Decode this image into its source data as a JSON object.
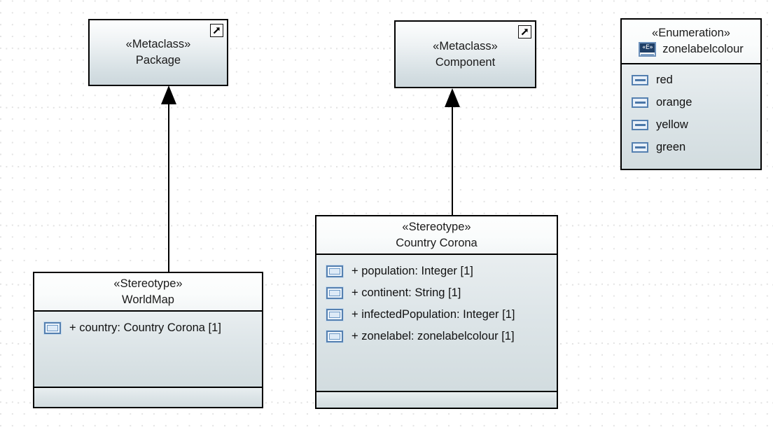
{
  "diagram": {
    "type": "uml-profile-diagram",
    "background": "#ffffff",
    "grid": "dotted"
  },
  "nodes": [
    {
      "id": "metaclass-package",
      "kind": "metaclass",
      "stereotype": "«Metaclass»",
      "name": "Package",
      "corner_icon": "external-link-icon"
    },
    {
      "id": "metaclass-component",
      "kind": "metaclass",
      "stereotype": "«Metaclass»",
      "name": "Component",
      "corner_icon": "external-link-icon"
    },
    {
      "id": "stereotype-worldmap",
      "kind": "stereotype",
      "stereotype": "«Stereotype»",
      "name": "WorldMap",
      "attributes": [
        {
          "icon": "property-icon",
          "text": "+ country: Country Corona [1]"
        }
      ]
    },
    {
      "id": "stereotype-country-corona",
      "kind": "stereotype",
      "stereotype": "«Stereotype»",
      "name": "Country Corona",
      "attributes": [
        {
          "icon": "property-icon",
          "text": "+ population: Integer [1]"
        },
        {
          "icon": "property-icon",
          "text": "+ continent: String [1]"
        },
        {
          "icon": "property-icon",
          "text": "+ infectedPopulation: Integer [1]"
        },
        {
          "icon": "property-icon",
          "text": "+ zonelabel: zonelabelcolour [1]"
        }
      ]
    },
    {
      "id": "enumeration-zonelabelcolour",
      "kind": "enumeration",
      "stereotype": "«Enumeration»",
      "name": "zonelabelcolour",
      "header_icon": "enumeration-icon",
      "header_icon_label": "«E»",
      "literals": [
        {
          "icon": "enum-literal-icon",
          "text": "red"
        },
        {
          "icon": "enum-literal-icon",
          "text": "orange"
        },
        {
          "icon": "enum-literal-icon",
          "text": "yellow"
        },
        {
          "icon": "enum-literal-icon",
          "text": "green"
        }
      ]
    }
  ],
  "connectors": [
    {
      "id": "extension-worldmap-package",
      "kind": "extension",
      "from": "stereotype-worldmap",
      "to": "metaclass-package",
      "arrow": "filled-triangle"
    },
    {
      "id": "extension-countrycorona-component",
      "kind": "extension",
      "from": "stereotype-country-corona",
      "to": "metaclass-component",
      "arrow": "filled-triangle"
    }
  ],
  "colors": {
    "border": "#000000",
    "fill_top": "#fdfefe",
    "fill_bottom": "#ccd7dc",
    "compartment_fill": "#d6e0e3",
    "icon_blue": "#5580b0",
    "enum_icon_dark": "#1f3f66"
  }
}
